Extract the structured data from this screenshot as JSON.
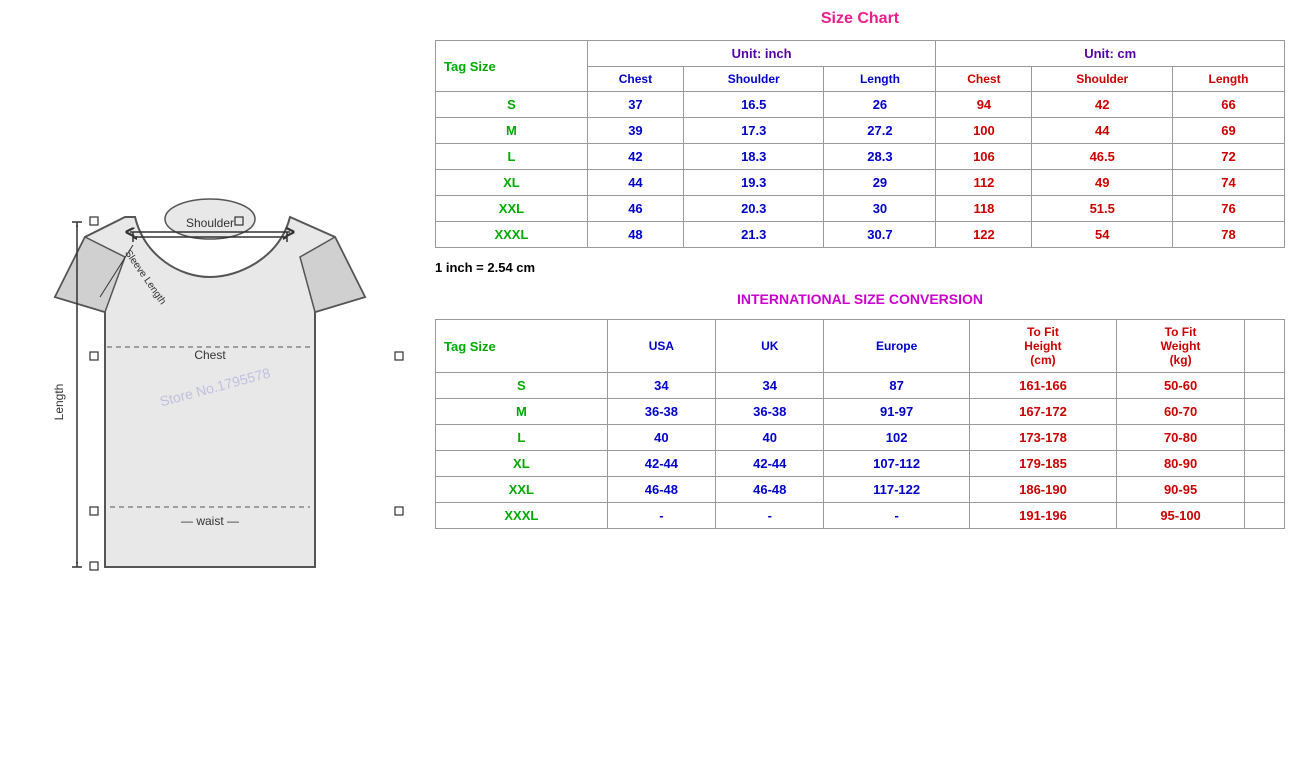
{
  "left": {
    "watermark": "Store No.1795578"
  },
  "right": {
    "size_chart_title": "Size Chart",
    "unit_inch": "Unit: inch",
    "unit_cm": "Unit: cm",
    "tag_size_label": "Tag Size",
    "inch_headers": [
      "Chest",
      "Shoulder",
      "Length"
    ],
    "cm_headers": [
      "Chest",
      "Shoulder",
      "Length"
    ],
    "size_rows": [
      {
        "tag": "S",
        "chest_in": "37",
        "shoulder_in": "16.5",
        "length_in": "26",
        "chest_cm": "94",
        "shoulder_cm": "42",
        "length_cm": "66"
      },
      {
        "tag": "M",
        "chest_in": "39",
        "shoulder_in": "17.3",
        "length_in": "27.2",
        "chest_cm": "100",
        "shoulder_cm": "44",
        "length_cm": "69"
      },
      {
        "tag": "L",
        "chest_in": "42",
        "shoulder_in": "18.3",
        "length_in": "28.3",
        "chest_cm": "106",
        "shoulder_cm": "46.5",
        "length_cm": "72"
      },
      {
        "tag": "XL",
        "chest_in": "44",
        "shoulder_in": "19.3",
        "length_in": "29",
        "chest_cm": "112",
        "shoulder_cm": "49",
        "length_cm": "74"
      },
      {
        "tag": "XXL",
        "chest_in": "46",
        "shoulder_in": "20.3",
        "length_in": "30",
        "chest_cm": "118",
        "shoulder_cm": "51.5",
        "length_cm": "76"
      },
      {
        "tag": "XXXL",
        "chest_in": "48",
        "shoulder_in": "21.3",
        "length_in": "30.7",
        "chest_cm": "122",
        "shoulder_cm": "54",
        "length_cm": "78"
      }
    ],
    "conversion_note": "1 inch = 2.54 cm",
    "intl_title": "INTERNATIONAL SIZE CONVERSION",
    "intl_tag_size_label": "Tag Size",
    "intl_headers": [
      "USA",
      "UK",
      "Europe",
      "To Fit Height (cm)",
      "To Fit Weight (kg)"
    ],
    "intl_rows": [
      {
        "tag": "S",
        "usa": "34",
        "uk": "34",
        "europe": "87",
        "height": "161-166",
        "weight": "50-60"
      },
      {
        "tag": "M",
        "usa": "36-38",
        "uk": "36-38",
        "europe": "91-97",
        "height": "167-172",
        "weight": "60-70"
      },
      {
        "tag": "L",
        "usa": "40",
        "uk": "40",
        "europe": "102",
        "height": "173-178",
        "weight": "70-80"
      },
      {
        "tag": "XL",
        "usa": "42-44",
        "uk": "42-44",
        "europe": "107-112",
        "height": "179-185",
        "weight": "80-90"
      },
      {
        "tag": "XXL",
        "usa": "46-48",
        "uk": "46-48",
        "europe": "117-122",
        "height": "186-190",
        "weight": "90-95"
      },
      {
        "tag": "XXXL",
        "usa": "-",
        "uk": "-",
        "europe": "-",
        "height": "191-196",
        "weight": "95-100"
      }
    ]
  }
}
